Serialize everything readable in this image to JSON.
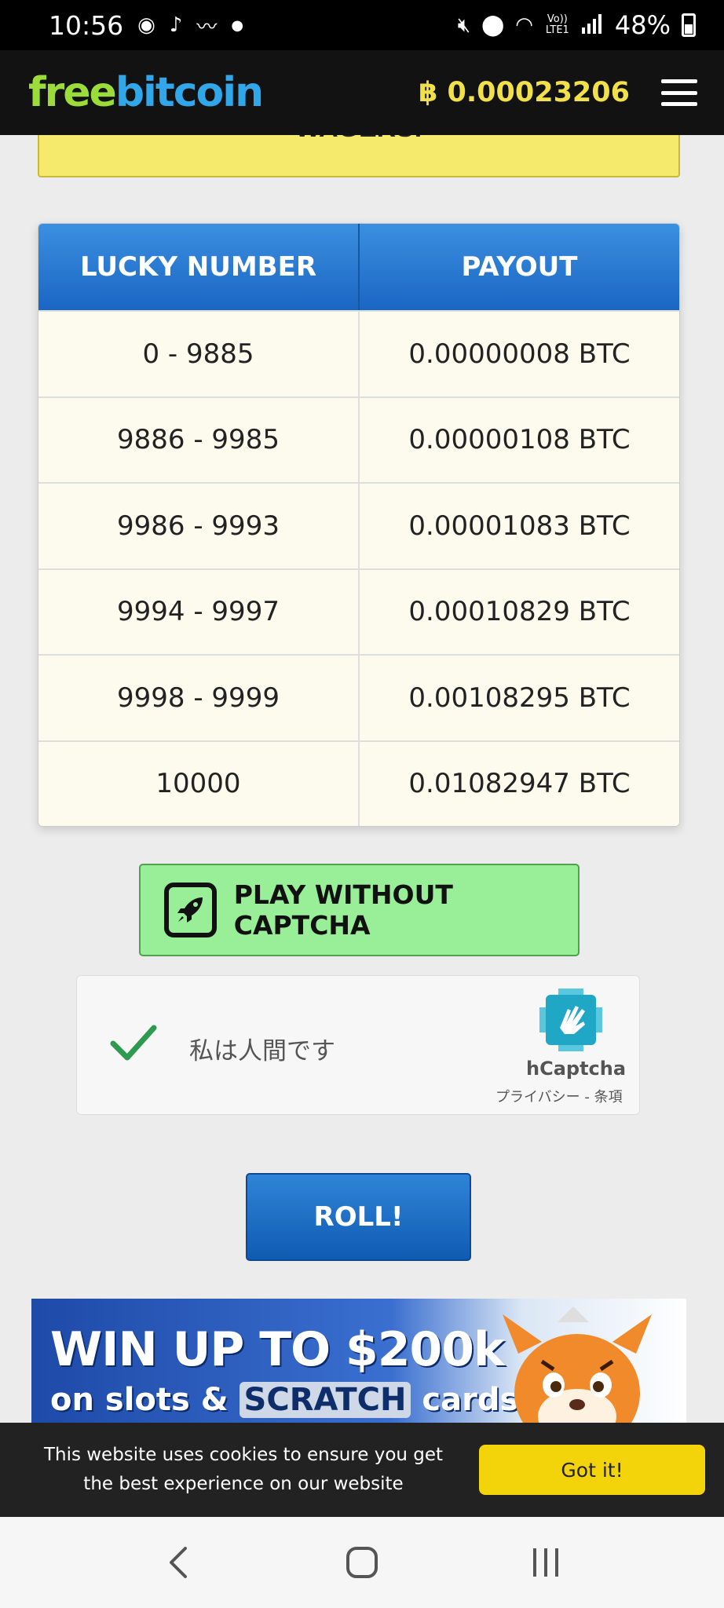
{
  "status_bar": {
    "time": "10:56",
    "battery": "48%",
    "signal_label": "Vo)) LTE1",
    "icons": [
      "eye-icon",
      "tiktok-icon",
      "app-icon",
      "dot-icon",
      "mute-icon",
      "location-icon",
      "wifi-icon",
      "signal-icon",
      "battery-icon"
    ]
  },
  "header": {
    "logo_free": "free",
    "logo_bitcoin": "bitcoin",
    "balance": "฿ 0.00023206",
    "logo_colors": {
      "free": "#9bdc3a",
      "bitcoin": "#31a6e8"
    }
  },
  "wager_banner": {
    "text": "WAGERS!"
  },
  "payout_table": {
    "headers": [
      "LUCKY NUMBER",
      "PAYOUT"
    ],
    "rows": [
      {
        "range": "0 - 9885",
        "payout": "0.00000008 BTC"
      },
      {
        "range": "9886 - 9985",
        "payout": "0.00000108 BTC"
      },
      {
        "range": "9986 - 9993",
        "payout": "0.00001083 BTC"
      },
      {
        "range": "9994 - 9997",
        "payout": "0.00010829 BTC"
      },
      {
        "range": "9998 - 9999",
        "payout": "0.00108295 BTC"
      },
      {
        "range": "10000",
        "payout": "0.01082947 BTC"
      }
    ]
  },
  "play_button": {
    "label": "PLAY WITHOUT CAPTCHA"
  },
  "captcha": {
    "text": "私は人間です",
    "brand": "hCaptcha",
    "links": "プライバシー - 条項"
  },
  "roll_button": {
    "label": "ROLL!"
  },
  "promo": {
    "line1": "WIN UP TO $200k",
    "line2_pre": "on slots & ",
    "line2_scratch": "SCRATCH",
    "line2_post": " cards"
  },
  "cookie": {
    "text": "This website uses cookies to ensure you get the best experience on our website",
    "button": "Got it!"
  },
  "system_nav": {
    "icons": [
      "back-icon",
      "home-icon",
      "recents-icon"
    ]
  }
}
